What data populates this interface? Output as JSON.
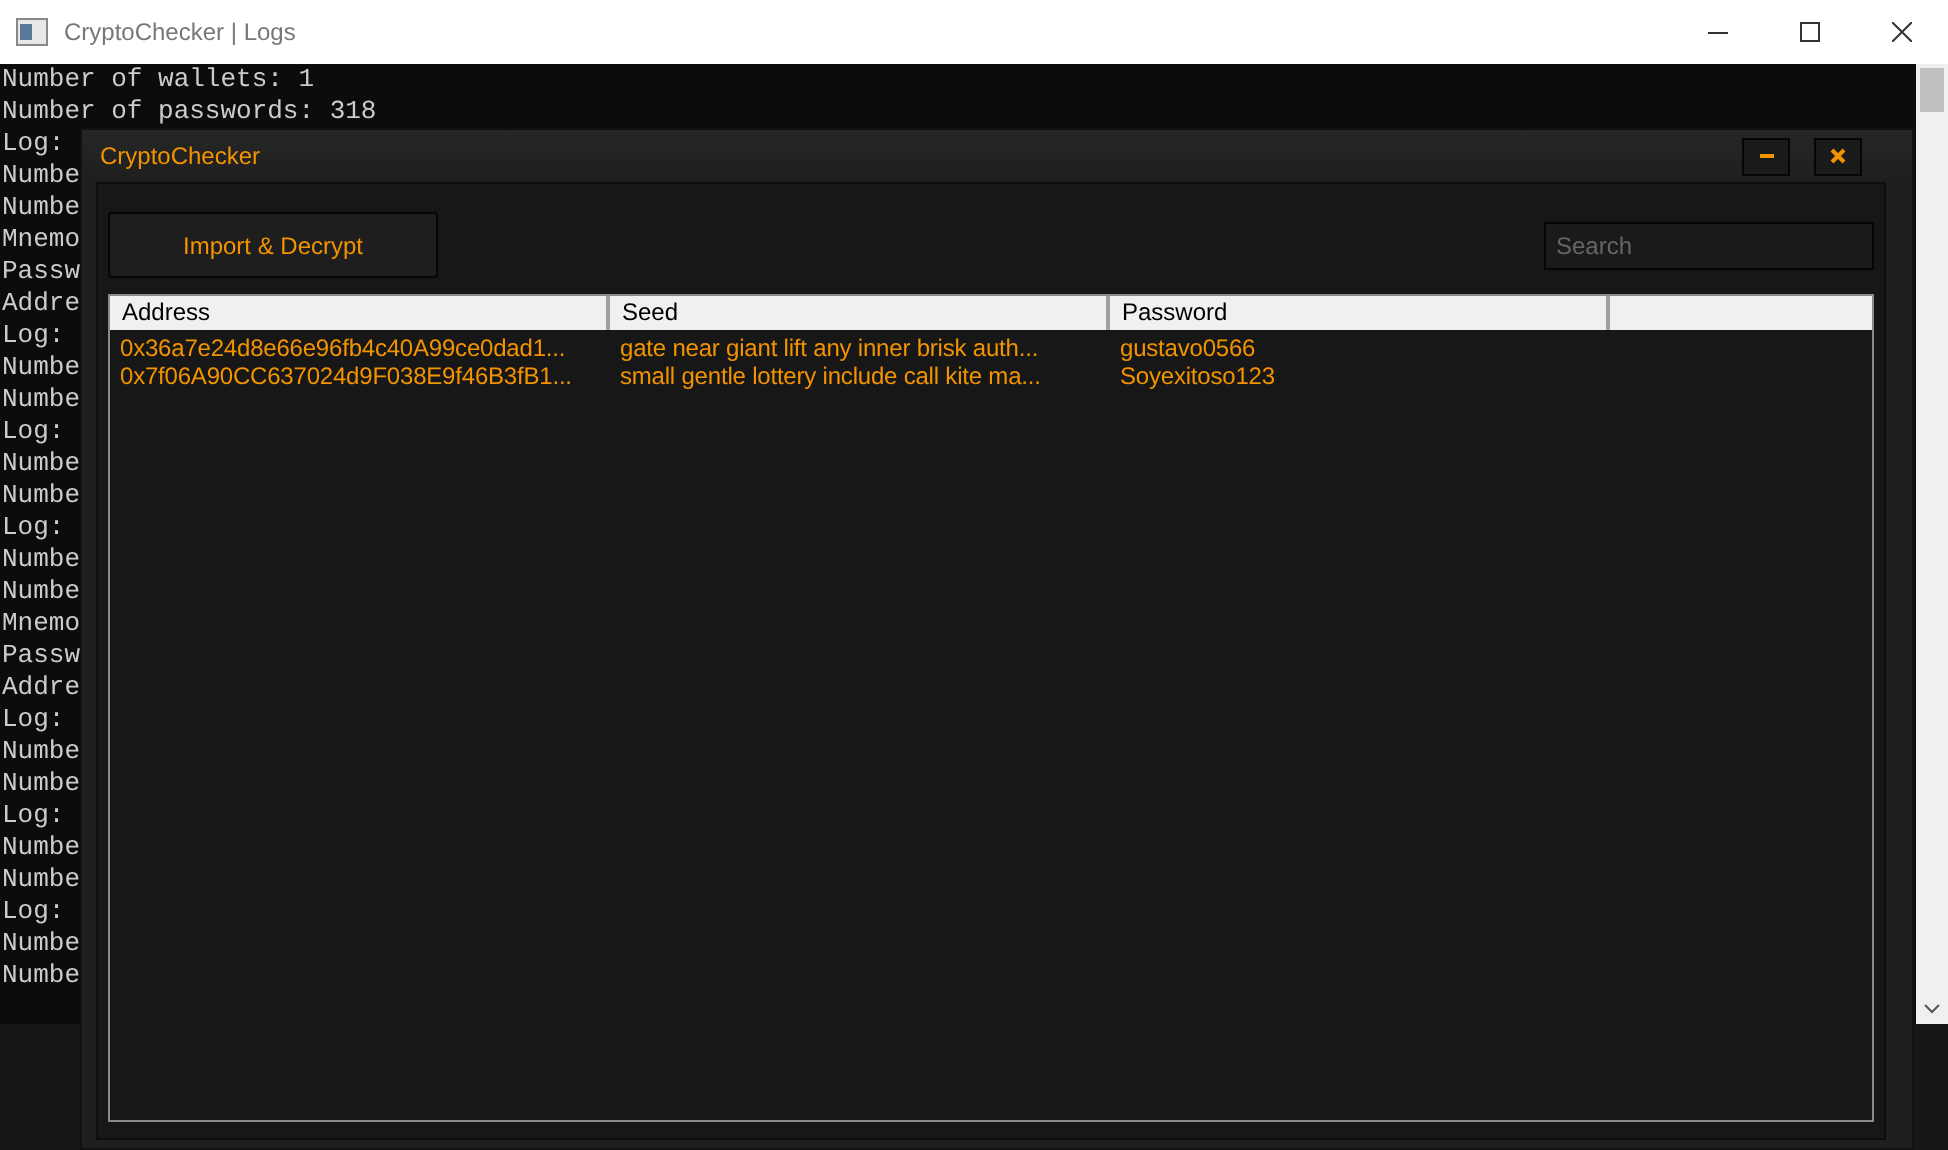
{
  "console_window": {
    "title": "CryptoChecker | Logs",
    "lines": [
      "Number of wallets: 1",
      "Number of passwords: 318",
      "Log:",
      "Numbe",
      "Numbe",
      "Mnemo",
      "Passw",
      "Addre",
      "Log:",
      "Numbe",
      "Numbe",
      "Log:",
      "Numbe",
      "Numbe",
      "Log:",
      "Numbe",
      "Numbe",
      "Mnemo",
      "Passw",
      "Addre",
      "Log:",
      "Numbe",
      "Numbe",
      "Log:",
      "Numbe",
      "Numbe",
      "Log:",
      "Numbe",
      "Numbe"
    ]
  },
  "app_window": {
    "title": "CryptoChecker",
    "import_button": "Import & Decrypt",
    "search": {
      "placeholder": "Search"
    },
    "table": {
      "columns": [
        "Address",
        "Seed",
        "Password"
      ],
      "rows": [
        [
          "0x36a7e24d8e66e96fb4c40A99ce0dad1...",
          "gate near giant lift any inner brisk auth...",
          "gustavo0566"
        ],
        [
          "0x7f06A90CC637024d9F038E9f46B3fB1...",
          "small gentle lottery include call kite ma...",
          "Soyexitoso123"
        ]
      ]
    }
  }
}
